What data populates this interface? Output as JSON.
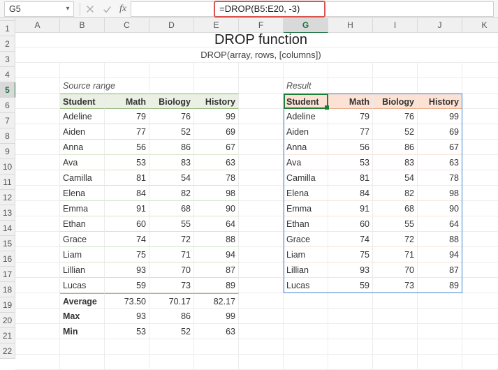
{
  "namebox": "G5",
  "formula": "=DROP(B5:E20, -3)",
  "colHeaders": [
    "A",
    "B",
    "C",
    "D",
    "E",
    "F",
    "G",
    "H",
    "I",
    "J",
    "K"
  ],
  "rowHeaders": [
    "1",
    "2",
    "3",
    "4",
    "5",
    "6",
    "7",
    "8",
    "9",
    "10",
    "11",
    "12",
    "13",
    "14",
    "15",
    "16",
    "17",
    "18",
    "19",
    "20",
    "21",
    "22"
  ],
  "title": "DROP function",
  "subtitle": "DROP(array, rows, [columns])",
  "sourceLabel": "Source range",
  "resultLabel": "Result",
  "headers": {
    "student": "Student",
    "math": "Math",
    "biology": "Biology",
    "history": "History"
  },
  "students": [
    {
      "name": "Adeline",
      "math": 79,
      "biology": 76,
      "history": 99
    },
    {
      "name": "Aiden",
      "math": 77,
      "biology": 52,
      "history": 69
    },
    {
      "name": "Anna",
      "math": 56,
      "biology": 86,
      "history": 67
    },
    {
      "name": "Ava",
      "math": 53,
      "biology": 83,
      "history": 63
    },
    {
      "name": "Camilla",
      "math": 81,
      "biology": 54,
      "history": 78
    },
    {
      "name": "Elena",
      "math": 84,
      "biology": 82,
      "history": 98
    },
    {
      "name": "Emma",
      "math": 91,
      "biology": 68,
      "history": 90
    },
    {
      "name": "Ethan",
      "math": 60,
      "biology": 55,
      "history": 64
    },
    {
      "name": "Grace",
      "math": 74,
      "biology": 72,
      "history": 88
    },
    {
      "name": "Liam",
      "math": 75,
      "biology": 71,
      "history": 94
    },
    {
      "name": "Lillian",
      "math": 93,
      "biology": 70,
      "history": 87
    },
    {
      "name": "Lucas",
      "math": 59,
      "biology": 73,
      "history": 89
    }
  ],
  "summary": {
    "averageLabel": "Average",
    "maxLabel": "Max",
    "minLabel": "Min",
    "average": {
      "math": "73.50",
      "biology": "70.17",
      "history": "82.17"
    },
    "max": {
      "math": 93,
      "biology": 86,
      "history": 99
    },
    "min": {
      "math": 53,
      "biology": 52,
      "history": 63
    }
  },
  "activeCol": "G",
  "activeRow": "5"
}
